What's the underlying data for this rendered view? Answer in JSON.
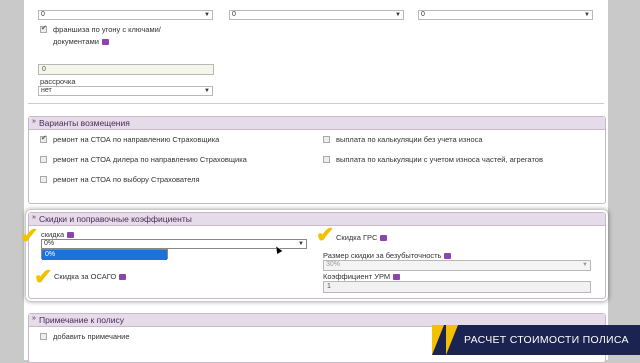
{
  "top": {
    "selects": [
      "0",
      "0",
      "0"
    ],
    "franchise_label_1": "франшиза по угону с ключами/",
    "franchise_label_2": "документами",
    "field_value": "0",
    "installment_label": "рассрочка",
    "installment_value": "нет"
  },
  "compensation": {
    "title": "Варианты возмещения",
    "left_options": [
      "ремонт на СТОА по направлению Страховщика",
      "ремонт на СТОА дилера по направлению Страховщика",
      "ремонт на СТОА по выбору Страхователя"
    ],
    "right_options": [
      "выплата по калькуляции без учета износа",
      "выплата по калькуляции с учетом износа частей, агрегатов"
    ]
  },
  "discounts": {
    "title": "Скидки и поправочные коэффициенты",
    "discount_label": "скидка",
    "discount_value": "0%",
    "dropdown_options": [
      "0%"
    ],
    "osago_label": "Скидка за ОСАГО",
    "grs_label": "Скидка ГРС",
    "loss_free_label": "Размер скидки за безубыточность",
    "loss_free_value": "30%",
    "urm_label": "Коэффициент УРМ",
    "urm_value": "1"
  },
  "note": {
    "title": "Примечание к полису",
    "add_note_label": "добавить примечание"
  },
  "banner": {
    "text": "РАСЧЕТ СТОИМОСТИ ПОЛИСА"
  },
  "colors": {
    "accent": "#f2c200",
    "panel_header": "#e6dbe9",
    "banner_bg": "#1b2350",
    "selection": "#1e72d6"
  }
}
